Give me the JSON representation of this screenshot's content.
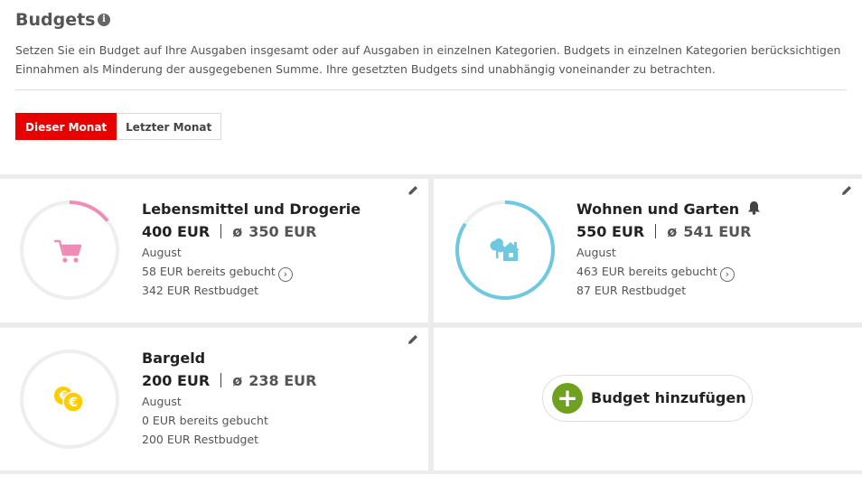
{
  "header": {
    "title": "Budgets",
    "info_glyph": "i",
    "description": "Setzen Sie ein Budget auf Ihre Ausgaben insgesamt oder auf Ausgaben in einzelnen Kategorien. Budgets in einzelnen Kategorien berücksichtigen Einnahmen als Minderung der ausgegebenen Summe. Ihre gesetzten Budgets sind unabhängig voneinander zu betrachten."
  },
  "tabs": [
    {
      "label": "Dieser Monat",
      "active": true
    },
    {
      "label": "Letzter Monat",
      "active": false
    }
  ],
  "colors": {
    "accent": "#e60000",
    "add_green": "#6fa01e",
    "ring_track": "#eeeeee"
  },
  "avg_symbol": "ø",
  "chevron_glyph": "›",
  "budgets": [
    {
      "name": "Lebensmittel und Drogerie",
      "amount": "400 EUR",
      "average": "350 EUR",
      "month": "August",
      "spent": "58 EUR bereits gebucht",
      "remaining": "342 EUR Restbudget",
      "progress": 0.145,
      "color": "#f08bb5",
      "icon": "shopping-cart-icon",
      "alert": false
    },
    {
      "name": "Wohnen und Garten",
      "amount": "550 EUR",
      "average": "541 EUR",
      "month": "August",
      "spent": "463 EUR bereits gebucht",
      "remaining": "87 EUR Restbudget",
      "progress": 0.842,
      "color": "#6ec8df",
      "icon": "house-tree-icon",
      "alert": true
    },
    {
      "name": "Bargeld",
      "amount": "200 EUR",
      "average": "238 EUR",
      "month": "August",
      "spent": "0 EUR bereits gebucht",
      "remaining": "200 EUR Restbudget",
      "progress": 0,
      "color": "#ffcc00",
      "icon": "euro-coins-icon",
      "alert": false
    }
  ],
  "add_budget": {
    "label": "Budget hinzufügen",
    "plus_glyph": "+"
  }
}
